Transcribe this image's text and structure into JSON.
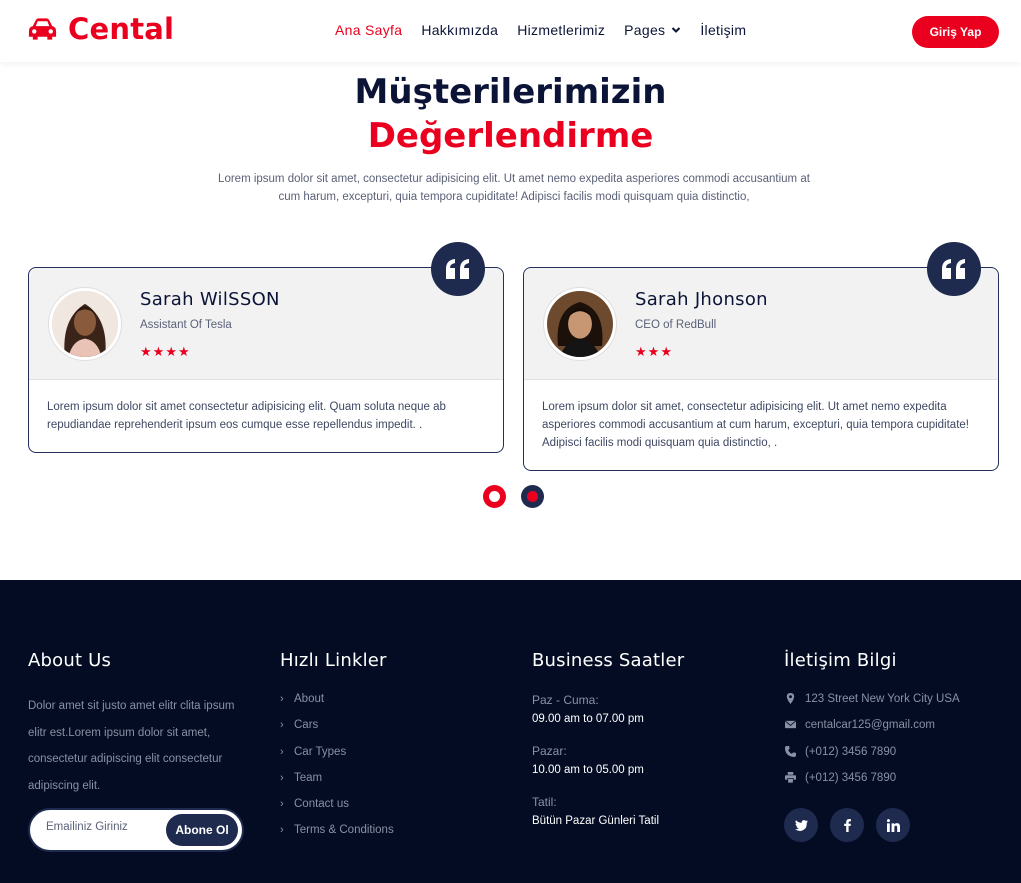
{
  "brand": {
    "name": "Cental",
    "color": "#ea001e"
  },
  "nav": {
    "items": [
      {
        "label": "Ana Sayfa",
        "active": true
      },
      {
        "label": "Hakkımızda"
      },
      {
        "label": "Hizmetlerimiz"
      },
      {
        "label": "Pages",
        "dropdown": true
      },
      {
        "label": "İletişim"
      }
    ],
    "login_label": "Giriş Yap"
  },
  "testimonials": {
    "title_line1": "Müşterilerimizin",
    "title_line2": "Değerlendirme",
    "description": "Lorem ipsum dolor sit amet, consectetur adipisicing elit. Ut amet nemo expedita asperiores commodi accusantium at cum harum, excepturi, quia tempora cupiditate! Adipisci facilis modi quisquam quia distinctio,",
    "items": [
      {
        "name": "Sarah WilSSON",
        "role": "Assistant Of Tesla",
        "rating": 4,
        "text": "Lorem ipsum dolor sit amet consectetur adipisicing elit. Quam soluta neque ab repudiandae reprehenderit ipsum eos cumque esse repellendus impedit. ."
      },
      {
        "name": "Sarah Jhonson",
        "role": "CEO of RedBull",
        "rating": 3,
        "text": "Lorem ipsum dolor sit amet, consectetur adipisicing elit. Ut amet nemo expedita asperiores commodi accusantium at cum harum, excepturi, quia tempora cupiditate! Adipisci facilis modi quisquam quia distinctio, ."
      }
    ],
    "carousel": {
      "slides": 2,
      "active_index": 1
    }
  },
  "footer": {
    "about": {
      "heading": "About Us",
      "text": "Dolor amet sit justo amet elitr clita ipsum elitr est.Lorem ipsum dolor sit amet, consectetur adipiscing elit consectetur adipiscing elit.",
      "email_placeholder": "Emailiniz Giriniz",
      "subscribe_label": "Abone Ol"
    },
    "links": {
      "heading": "Hızlı Linkler",
      "items": [
        "About",
        "Cars",
        "Car Types",
        "Team",
        "Contact us",
        "Terms & Conditions"
      ]
    },
    "hours": {
      "heading": "Business Saatler",
      "rows": [
        {
          "label": "Paz - Cuma:",
          "value": "09.00 am to 07.00 pm"
        },
        {
          "label": "Pazar:",
          "value": "10.00 am to 05.00 pm"
        },
        {
          "label": "Tatil:",
          "value": "Bütün Pazar Günleri Tatil"
        }
      ]
    },
    "contact": {
      "heading": "İletişim Bilgi",
      "items": [
        {
          "icon": "map-marker-icon",
          "text": "123 Street New York City USA"
        },
        {
          "icon": "envelope-icon",
          "text": "centalcar125@gmail.com"
        },
        {
          "icon": "phone-icon",
          "text": "(+012) 3456 7890"
        },
        {
          "icon": "printer-icon",
          "text": "(+012) 3456 7890"
        }
      ],
      "socials": [
        "twitter-icon",
        "facebook-icon",
        "linkedin-icon"
      ]
    }
  },
  "colors": {
    "primary": "#ea001e",
    "navy": "#1e2b4f",
    "footer_bg": "#030c22"
  }
}
